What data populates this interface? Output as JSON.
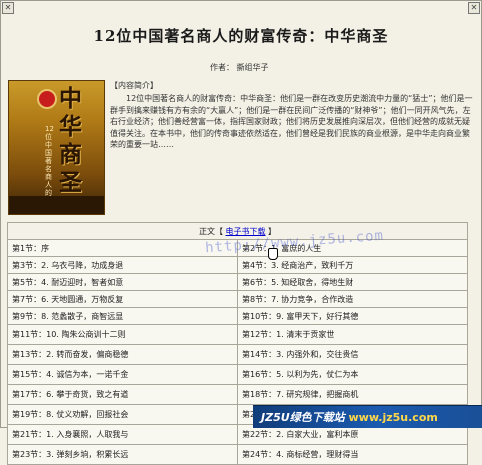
{
  "title": "12位中国著名商人的财富传奇：中华商圣",
  "author": {
    "label": "作者：",
    "name": "撕组华子"
  },
  "cover": {
    "big_text": "中华商圣",
    "vertical_text": "12位中国著名商人的财富传奇"
  },
  "intro": {
    "heading": "【内容简介】",
    "text": "12位中国著名商人的财富传奇：中华商圣：他们是一群在改变历史潮流中力量的“猛士”；他们是一群手到擒来赚钱有方有余的“大赢人”；他们是一群在民间广泛传播的“财神爷”；他们一同开风气先，左右行业经济；他们善经营富一体，指挥国家财政；他们将历史发展推向深层次，但他们经营的成就无疑值得关注。在本书中，他们的传奇事迹依然适在，他们曾经是我们民族的商业根源，是中华走向商业繁荣的重要一站……"
  },
  "download_header": {
    "prefix": "正文【 ",
    "link": "电子书下载",
    "suffix": " 】"
  },
  "watermark": "http://www.jz5u.com",
  "chapters": [
    [
      "第1节：序",
      "第2节：1. 富庶的人生"
    ],
    [
      "第3节：2. 乌衣弓降，功成身退",
      "第4节：3. 经商治产，致利千万"
    ],
    [
      "第5节：4. 耐迈迎时，智者如意",
      "第6节：5. 知经取舍，得地生财"
    ],
    [
      "第7节：6. 天地圆通，万物反复",
      "第8节：7. 协力竞争，合作改造"
    ],
    [
      "第9节：8. 范蠡散子，商智远显",
      "第10节：9. 富甲天下，好行其德"
    ],
    [
      "第11节：10. 陶朱公商训十二则",
      "第12节：1. 清末于贡家世"
    ],
    [
      "第13节：2. 转而奋发，偏商稳德",
      "第14节：3. 内强外和，交往贵信"
    ],
    [
      "第15节：4. 诚信为本，一诺千金",
      "第16节：5. 以利为先，仗仁为本"
    ],
    [
      "第17节：6. 攀于奇货，致之有道",
      "第18节：7. 研究规律，把握商机"
    ],
    [
      "第19节：8. 仗义劝解，回报社会",
      "第20节：9. 我带的精籍传商定义"
    ],
    [
      "第21节：1. 入身襄照，人取我与",
      "第22节：2. 白家大业，富利本原"
    ],
    [
      "第23节：3. 弹刻乡垧，积累长远",
      "第24节：4. 商标经营，理财得当"
    ]
  ],
  "banner": {
    "text": "JZ5U绿色下载站",
    "site": "www.jz5u.com"
  },
  "colors": {
    "link": "#0000cc",
    "banner_bg": "#1b5bb0",
    "banner_site": "#ffd84a"
  }
}
